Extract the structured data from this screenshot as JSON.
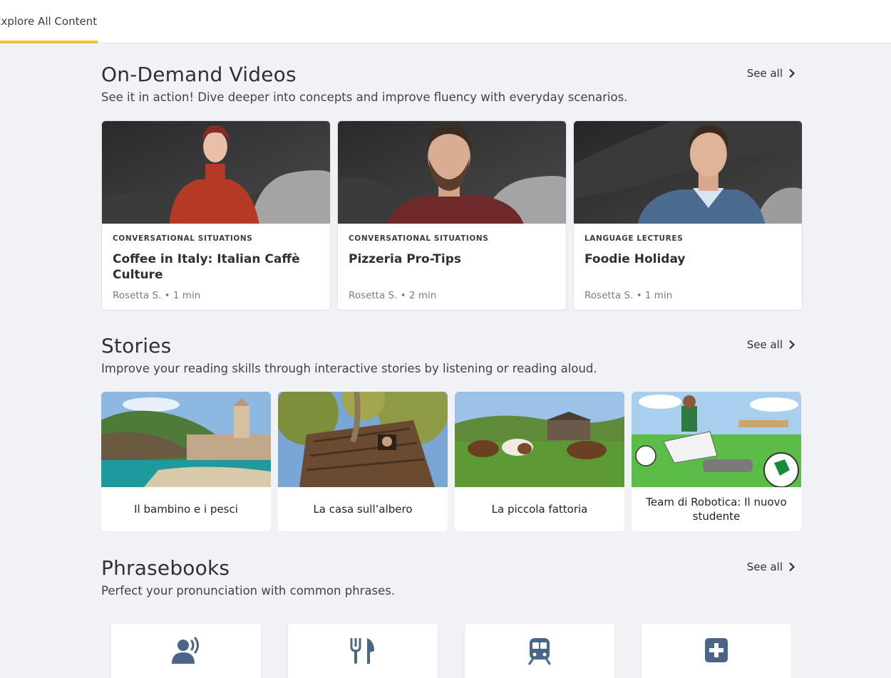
{
  "tabs": {
    "active_label": "Explore All Content"
  },
  "colors": {
    "accent": "#f0c233",
    "icon": "#4a6585",
    "background": "#f1f2f6"
  },
  "videos": {
    "title": "On-Demand Videos",
    "subtitle": "See it in action! Dive deeper into concepts and improve fluency with everyday scenarios.",
    "see_all": "See all",
    "items": [
      {
        "category": "Conversational Situations",
        "title": "Coffee in Italy: Italian Caffè Culture",
        "meta": "Rosetta S. • 1 min"
      },
      {
        "category": "Conversational Situations",
        "title": "Pizzeria Pro-Tips",
        "meta": "Rosetta S. • 2 min"
      },
      {
        "category": "Language Lectures",
        "title": "Foodie Holiday",
        "meta": "Rosetta S. • 1 min"
      }
    ]
  },
  "stories": {
    "title": "Stories",
    "subtitle": "Improve your reading skills through interactive stories by listening or reading aloud.",
    "see_all": "See all",
    "items": [
      {
        "title": "Il bambino e i pesci"
      },
      {
        "title": "La casa sull’albero"
      },
      {
        "title": "La piccola fattoria"
      },
      {
        "title": "Team di Robotica: Il nuovo studente"
      }
    ]
  },
  "phrasebooks": {
    "title": "Phrasebooks",
    "subtitle": "Perfect your pronunciation with common phrases.",
    "see_all": "See all",
    "icons": [
      "speaking-person-icon",
      "fork-knife-icon",
      "train-icon",
      "medical-cross-icon"
    ]
  }
}
